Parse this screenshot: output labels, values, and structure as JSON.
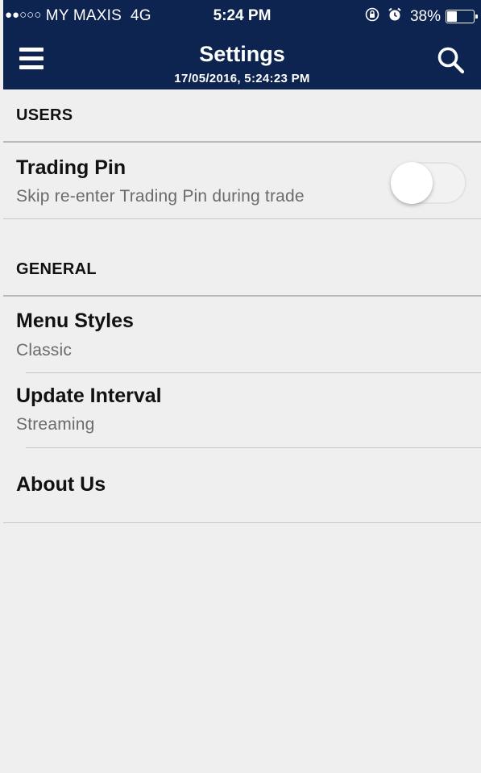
{
  "status_bar": {
    "signal_dots": "●●○○○",
    "carrier": "MY MAXIS",
    "network": "4G",
    "time": "5:24 PM",
    "battery_percent": "38%",
    "battery_level": 0.38,
    "icons": [
      "rotation-lock-icon",
      "alarm-icon"
    ]
  },
  "nav": {
    "title": "Settings",
    "subtitle": "17/05/2016, 5:24:23 PM",
    "left_icon": "hamburger-menu-icon",
    "right_icon": "search-icon"
  },
  "sections": {
    "users": {
      "header": "USERS",
      "trading_pin": {
        "title": "Trading Pin",
        "subtitle": "Skip re-enter Trading Pin during trade",
        "toggle_on": false
      }
    },
    "general": {
      "header": "GENERAL",
      "menu_styles": {
        "title": "Menu Styles",
        "value": "Classic"
      },
      "update_interval": {
        "title": "Update Interval",
        "value": "Streaming"
      },
      "about_us": {
        "title": "About Us"
      }
    }
  },
  "colors": {
    "header_bg": "#0d2350",
    "page_bg": "#efefef"
  }
}
